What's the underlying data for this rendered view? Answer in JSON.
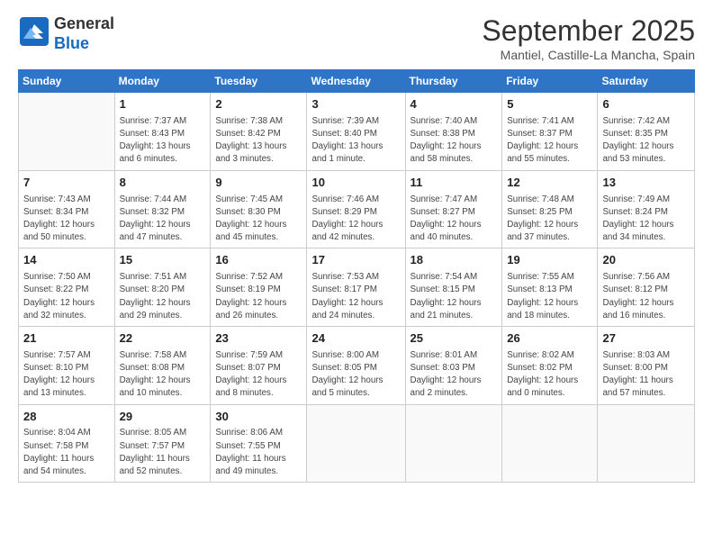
{
  "header": {
    "logo_general": "General",
    "logo_blue": "Blue",
    "month_year": "September 2025",
    "location": "Mantiel, Castille-La Mancha, Spain"
  },
  "days_of_week": [
    "Sunday",
    "Monday",
    "Tuesday",
    "Wednesday",
    "Thursday",
    "Friday",
    "Saturday"
  ],
  "weeks": [
    [
      {
        "day": "",
        "content": ""
      },
      {
        "day": "1",
        "content": "Sunrise: 7:37 AM\nSunset: 8:43 PM\nDaylight: 13 hours\nand 6 minutes."
      },
      {
        "day": "2",
        "content": "Sunrise: 7:38 AM\nSunset: 8:42 PM\nDaylight: 13 hours\nand 3 minutes."
      },
      {
        "day": "3",
        "content": "Sunrise: 7:39 AM\nSunset: 8:40 PM\nDaylight: 13 hours\nand 1 minute."
      },
      {
        "day": "4",
        "content": "Sunrise: 7:40 AM\nSunset: 8:38 PM\nDaylight: 12 hours\nand 58 minutes."
      },
      {
        "day": "5",
        "content": "Sunrise: 7:41 AM\nSunset: 8:37 PM\nDaylight: 12 hours\nand 55 minutes."
      },
      {
        "day": "6",
        "content": "Sunrise: 7:42 AM\nSunset: 8:35 PM\nDaylight: 12 hours\nand 53 minutes."
      }
    ],
    [
      {
        "day": "7",
        "content": "Sunrise: 7:43 AM\nSunset: 8:34 PM\nDaylight: 12 hours\nand 50 minutes."
      },
      {
        "day": "8",
        "content": "Sunrise: 7:44 AM\nSunset: 8:32 PM\nDaylight: 12 hours\nand 47 minutes."
      },
      {
        "day": "9",
        "content": "Sunrise: 7:45 AM\nSunset: 8:30 PM\nDaylight: 12 hours\nand 45 minutes."
      },
      {
        "day": "10",
        "content": "Sunrise: 7:46 AM\nSunset: 8:29 PM\nDaylight: 12 hours\nand 42 minutes."
      },
      {
        "day": "11",
        "content": "Sunrise: 7:47 AM\nSunset: 8:27 PM\nDaylight: 12 hours\nand 40 minutes."
      },
      {
        "day": "12",
        "content": "Sunrise: 7:48 AM\nSunset: 8:25 PM\nDaylight: 12 hours\nand 37 minutes."
      },
      {
        "day": "13",
        "content": "Sunrise: 7:49 AM\nSunset: 8:24 PM\nDaylight: 12 hours\nand 34 minutes."
      }
    ],
    [
      {
        "day": "14",
        "content": "Sunrise: 7:50 AM\nSunset: 8:22 PM\nDaylight: 12 hours\nand 32 minutes."
      },
      {
        "day": "15",
        "content": "Sunrise: 7:51 AM\nSunset: 8:20 PM\nDaylight: 12 hours\nand 29 minutes."
      },
      {
        "day": "16",
        "content": "Sunrise: 7:52 AM\nSunset: 8:19 PM\nDaylight: 12 hours\nand 26 minutes."
      },
      {
        "day": "17",
        "content": "Sunrise: 7:53 AM\nSunset: 8:17 PM\nDaylight: 12 hours\nand 24 minutes."
      },
      {
        "day": "18",
        "content": "Sunrise: 7:54 AM\nSunset: 8:15 PM\nDaylight: 12 hours\nand 21 minutes."
      },
      {
        "day": "19",
        "content": "Sunrise: 7:55 AM\nSunset: 8:13 PM\nDaylight: 12 hours\nand 18 minutes."
      },
      {
        "day": "20",
        "content": "Sunrise: 7:56 AM\nSunset: 8:12 PM\nDaylight: 12 hours\nand 16 minutes."
      }
    ],
    [
      {
        "day": "21",
        "content": "Sunrise: 7:57 AM\nSunset: 8:10 PM\nDaylight: 12 hours\nand 13 minutes."
      },
      {
        "day": "22",
        "content": "Sunrise: 7:58 AM\nSunset: 8:08 PM\nDaylight: 12 hours\nand 10 minutes."
      },
      {
        "day": "23",
        "content": "Sunrise: 7:59 AM\nSunset: 8:07 PM\nDaylight: 12 hours\nand 8 minutes."
      },
      {
        "day": "24",
        "content": "Sunrise: 8:00 AM\nSunset: 8:05 PM\nDaylight: 12 hours\nand 5 minutes."
      },
      {
        "day": "25",
        "content": "Sunrise: 8:01 AM\nSunset: 8:03 PM\nDaylight: 12 hours\nand 2 minutes."
      },
      {
        "day": "26",
        "content": "Sunrise: 8:02 AM\nSunset: 8:02 PM\nDaylight: 12 hours\nand 0 minutes."
      },
      {
        "day": "27",
        "content": "Sunrise: 8:03 AM\nSunset: 8:00 PM\nDaylight: 11 hours\nand 57 minutes."
      }
    ],
    [
      {
        "day": "28",
        "content": "Sunrise: 8:04 AM\nSunset: 7:58 PM\nDaylight: 11 hours\nand 54 minutes."
      },
      {
        "day": "29",
        "content": "Sunrise: 8:05 AM\nSunset: 7:57 PM\nDaylight: 11 hours\nand 52 minutes."
      },
      {
        "day": "30",
        "content": "Sunrise: 8:06 AM\nSunset: 7:55 PM\nDaylight: 11 hours\nand 49 minutes."
      },
      {
        "day": "",
        "content": ""
      },
      {
        "day": "",
        "content": ""
      },
      {
        "day": "",
        "content": ""
      },
      {
        "day": "",
        "content": ""
      }
    ]
  ]
}
